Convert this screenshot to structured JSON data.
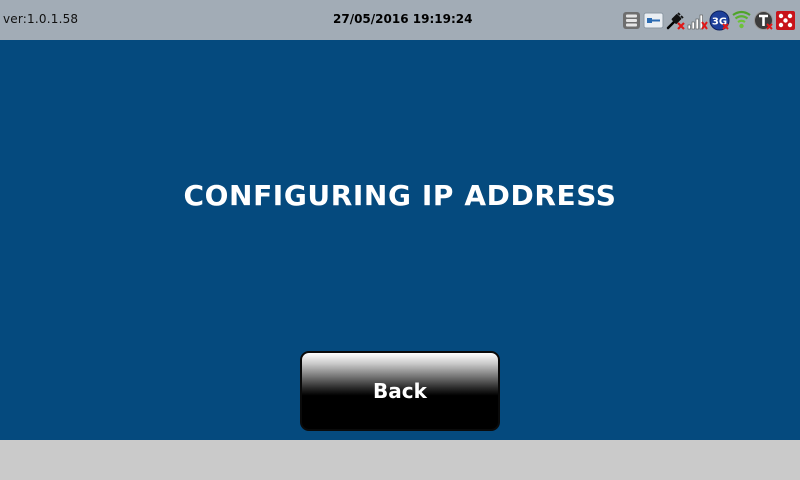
{
  "status_bar": {
    "version": "ver:1.0.1.58",
    "datetime": "27/05/2016 19:19:24",
    "network_badge": "3G",
    "tray_icons": [
      "storage-icon",
      "ethernet-icon",
      "usb-plug-icon",
      "signal-bars-icon",
      "3g-icon",
      "wifi-icon",
      "t-badge-icon",
      "printer-status-icon"
    ]
  },
  "main": {
    "title": "CONFIGURING IP ADDRESS",
    "back_label": "Back"
  },
  "colors": {
    "status_bar_bg": "#a2acb6",
    "main_bg": "#054a7e",
    "footer_bg": "#cacaca",
    "title_text": "#ffffff"
  }
}
